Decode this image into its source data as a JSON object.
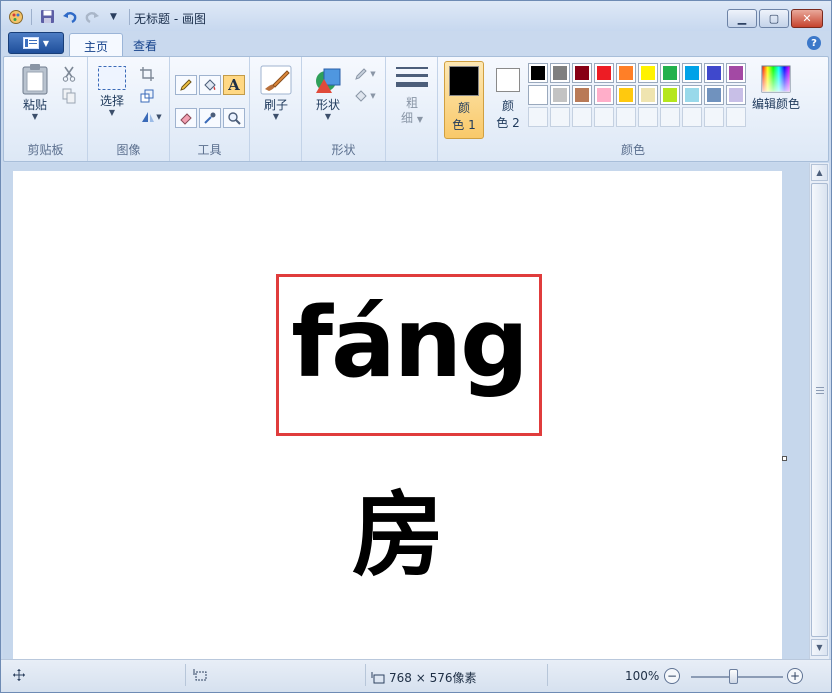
{
  "window": {
    "title": "无标题 - 画图"
  },
  "tabs": {
    "home": "主页",
    "view": "查看"
  },
  "ribbon": {
    "clipboard": {
      "label": "剪贴板",
      "paste": "粘贴"
    },
    "image": {
      "label": "图像",
      "select": "选择"
    },
    "tools": {
      "label": "工具"
    },
    "brushes": {
      "label": "刷子"
    },
    "shapes": {
      "label": "形状",
      "button": "形状"
    },
    "size": {
      "line1": "粗",
      "line2": "细"
    },
    "colors": {
      "label": "颜色",
      "color1_l1": "颜",
      "color1_l2": "色 1",
      "color2_l1": "颜",
      "color2_l2": "色 2",
      "edit": "编辑颜色",
      "color1_value": "#000000",
      "color2_value": "#ffffff",
      "palette": [
        "#000000",
        "#7f7f7f",
        "#880015",
        "#ed1c24",
        "#ff7f27",
        "#fff200",
        "#22b14c",
        "#00a2e8",
        "#3f48cc",
        "#a349a4",
        "#ffffff",
        "#c3c3c3",
        "#b97a57",
        "#ffaec9",
        "#ffc90e",
        "#efe4b0",
        "#b5e61d",
        "#99d9ea",
        "#7092be",
        "#c8bfe7"
      ],
      "custom_slots": 10
    }
  },
  "canvas": {
    "pinyin": "fáng",
    "hanzi": "房",
    "box_color": "#e03c3c"
  },
  "status": {
    "size_text": "768 × 576像素",
    "zoom": "100%",
    "zoom_level": 1.0
  }
}
